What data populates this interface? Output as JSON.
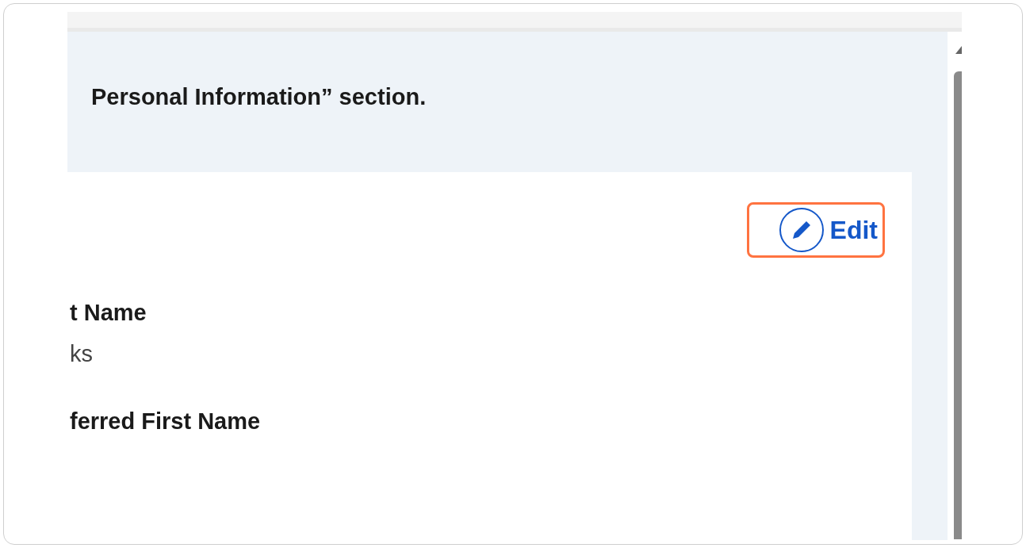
{
  "instruction": "Personal Information” section.",
  "edit_button": {
    "label": "Edit",
    "highlighted": true
  },
  "fields": [
    {
      "label": "t Name",
      "value": "ks"
    },
    {
      "label": "ferred First Name"
    }
  ]
}
